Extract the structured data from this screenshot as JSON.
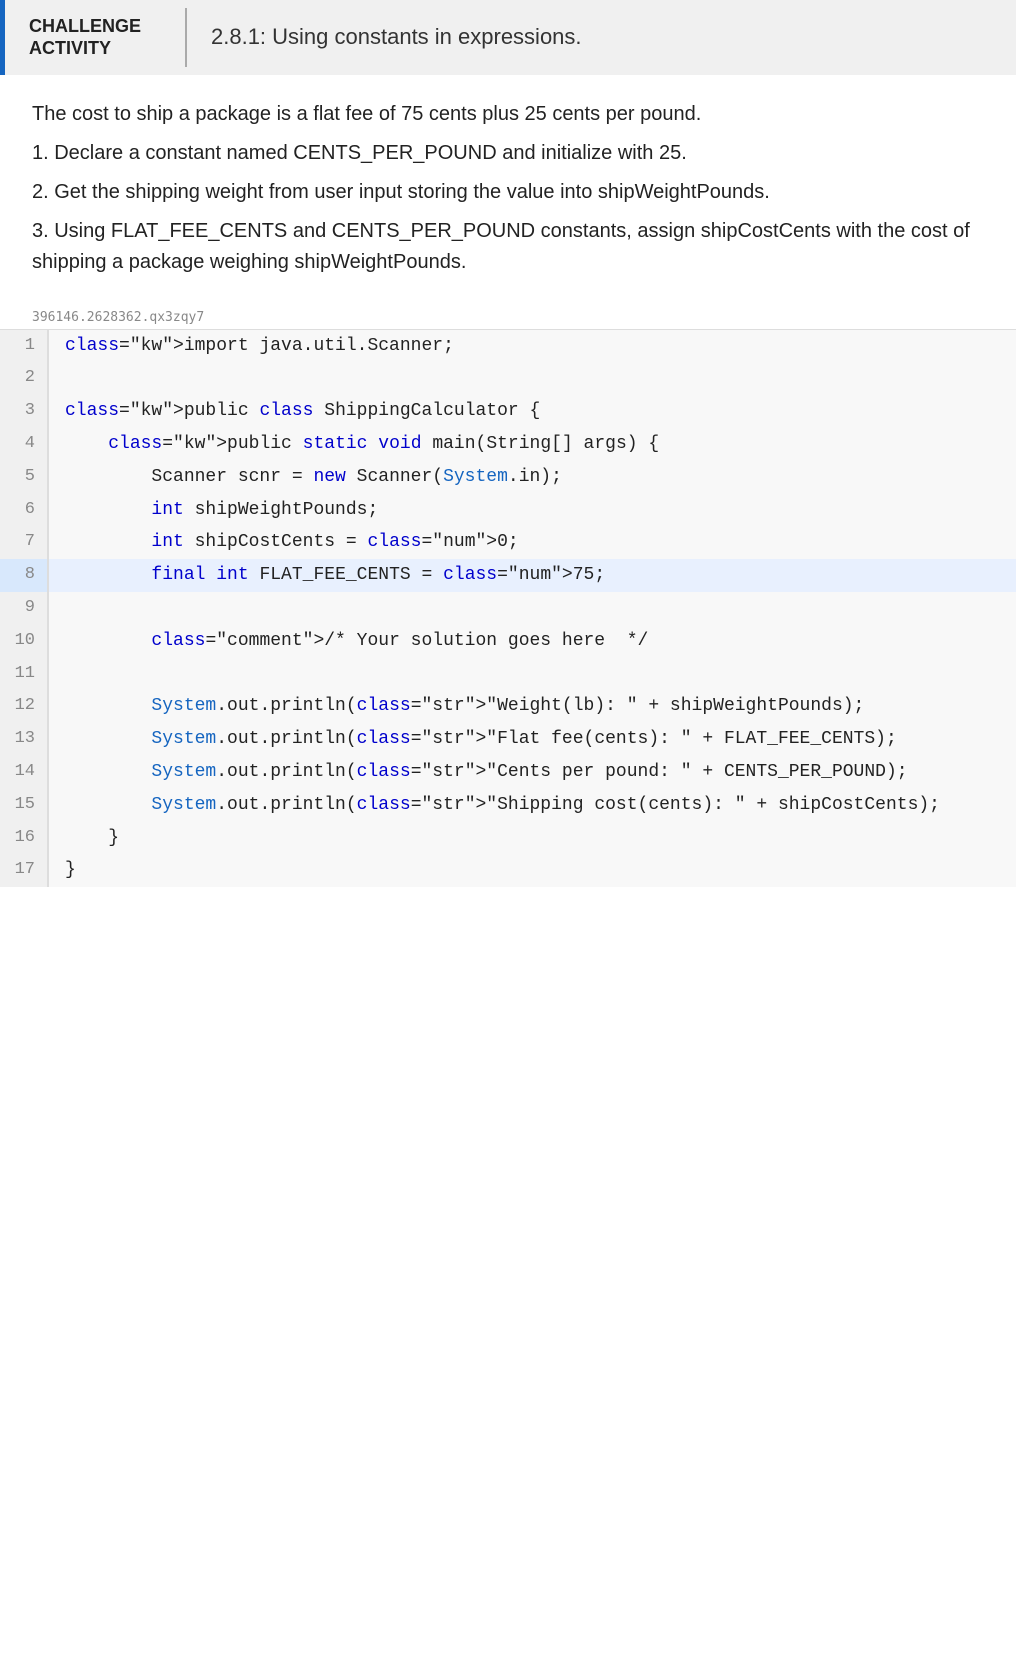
{
  "header": {
    "label_line1": "CHALLENGE",
    "label_line2": "ACTIVITY",
    "title": "2.8.1: Using constants in expressions."
  },
  "description": {
    "intro": "The cost to ship a package is a flat fee of 75 cents plus 25 cents per pound.",
    "step1": "1. Declare a constant named CENTS_PER_POUND and initialize with 25.",
    "step2": "2. Get the shipping weight from user input storing the value into shipWeightPounds.",
    "step3": "3. Using FLAT_FEE_CENTS and CENTS_PER_POUND constants, assign shipCostCents with the cost of shipping a package weighing shipWeightPounds."
  },
  "file_label": "396146.2628362.qx3zqy7",
  "code": {
    "lines": [
      {
        "num": 1,
        "text": "import java.util.Scanner;",
        "highlight": false
      },
      {
        "num": 2,
        "text": "",
        "highlight": false
      },
      {
        "num": 3,
        "text": "public class ShippingCalculator {",
        "highlight": false
      },
      {
        "num": 4,
        "text": "    public static void main(String[] args) {",
        "highlight": false
      },
      {
        "num": 5,
        "text": "        Scanner scnr = new Scanner(System.in);",
        "highlight": false
      },
      {
        "num": 6,
        "text": "        int shipWeightPounds;",
        "highlight": false
      },
      {
        "num": 7,
        "text": "        int shipCostCents = 0;",
        "highlight": false
      },
      {
        "num": 8,
        "text": "        final int FLAT_FEE_CENTS = 75;",
        "highlight": true
      },
      {
        "num": 9,
        "text": "",
        "highlight": false
      },
      {
        "num": 10,
        "text": "        /* Your solution goes here  */",
        "highlight": false
      },
      {
        "num": 11,
        "text": "",
        "highlight": false
      },
      {
        "num": 12,
        "text": "        System.out.println(\"Weight(lb): \" + shipWeightPounds);",
        "highlight": false
      },
      {
        "num": 13,
        "text": "        System.out.println(\"Flat fee(cents): \" + FLAT_FEE_CENTS);",
        "highlight": false
      },
      {
        "num": 14,
        "text": "        System.out.println(\"Cents per pound: \" + CENTS_PER_POUND);",
        "highlight": false
      },
      {
        "num": 15,
        "text": "        System.out.println(\"Shipping cost(cents): \" + shipCostCents);",
        "highlight": false
      },
      {
        "num": 16,
        "text": "    }",
        "highlight": false
      },
      {
        "num": 17,
        "text": "}",
        "highlight": false
      }
    ]
  }
}
